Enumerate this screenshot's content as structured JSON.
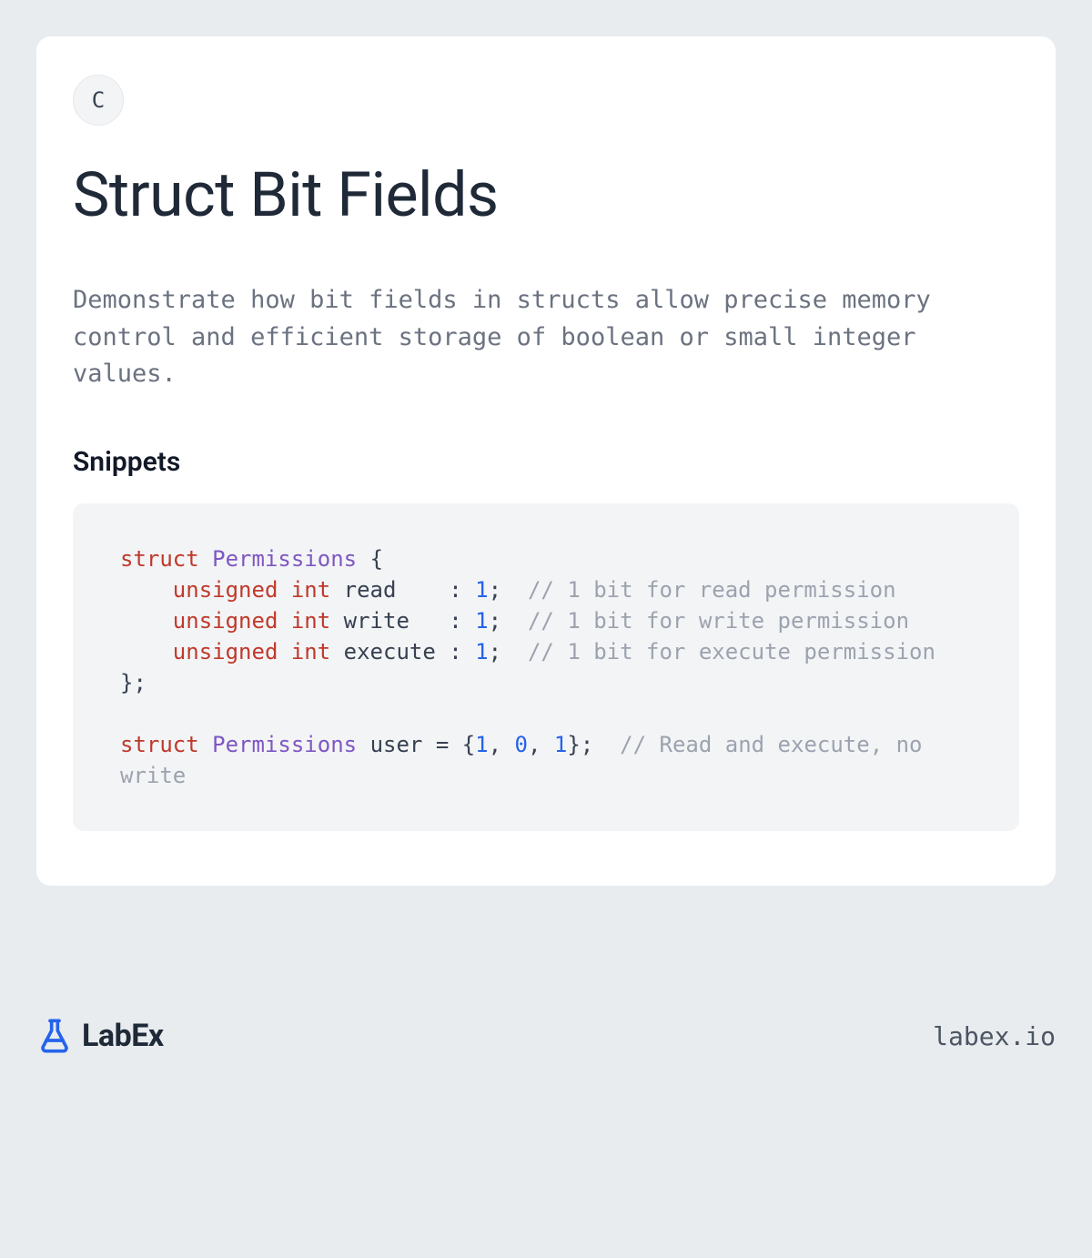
{
  "badge_letter": "C",
  "title": "Struct Bit Fields",
  "description": "Demonstrate how bit fields in structs allow precise memory control and efficient storage of boolean or small integer values.",
  "snippets_heading": "Snippets",
  "code": {
    "kw_struct": "struct",
    "typename": "Permissions",
    "brace_open": "{",
    "kw_unsigned": "unsigned",
    "kw_int": "int",
    "field_read": "read",
    "field_write": "write",
    "field_execute": "execute",
    "colon": ":",
    "bit1": "1",
    "semi": ";",
    "comment_read": "// 1 bit for read permission",
    "comment_write": "// 1 bit for write permission",
    "comment_execute": "// 1 bit for execute permission",
    "brace_close_semi": "};",
    "var_user": "user",
    "eq": "=",
    "brace_open2": "{",
    "v1": "1",
    "comma": ",",
    "v0": "0",
    "brace_close2": "}",
    "comment_init": "// Read and execute, no write"
  },
  "brand_name": "LabEx",
  "brand_url": "labex.io",
  "colors": {
    "page_bg": "#e9ecef",
    "card_bg": "#ffffff",
    "code_bg": "#f3f4f6",
    "brand_blue": "#2563eb",
    "kw_red": "#c0392b",
    "type_purple": "#7e57c2",
    "num_blue": "#2563eb",
    "comment_gray": "#9ca3af"
  }
}
